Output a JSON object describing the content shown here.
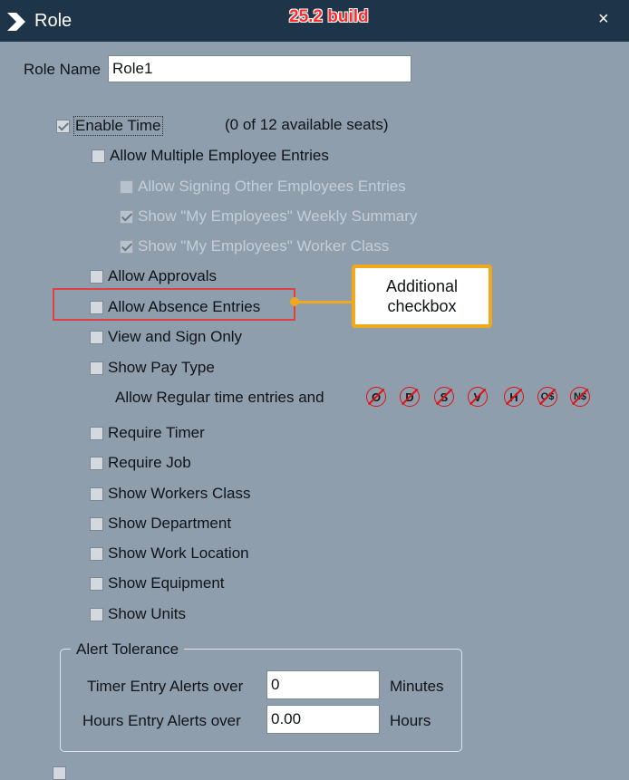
{
  "window": {
    "title": "Role",
    "build": "25.2 build",
    "close": "×"
  },
  "role_name": {
    "label": "Role Name",
    "value": "Role1"
  },
  "enable_time": {
    "label": "Enable Time",
    "checked": true,
    "seats": "(0 of 12 available seats)"
  },
  "options": [
    {
      "label": "Allow Multiple Employee Entries",
      "checked": false,
      "disabled": false
    },
    {
      "label": "Allow Signing Other Employees Entries",
      "checked": false,
      "disabled": true
    },
    {
      "label": "Show \"My Employees\" Weekly Summary",
      "checked": true,
      "disabled": true
    },
    {
      "label": "Show \"My Employees\" Worker Class",
      "checked": true,
      "disabled": true
    },
    {
      "label": "Allow Approvals",
      "checked": false,
      "disabled": false
    },
    {
      "label": "Allow Absence Entries",
      "checked": false,
      "disabled": false
    },
    {
      "label": "View and Sign Only",
      "checked": false,
      "disabled": false
    },
    {
      "label": "Show Pay Type",
      "checked": false,
      "disabled": false
    },
    {
      "label": "Require Timer",
      "checked": false,
      "disabled": false
    },
    {
      "label": "Require Job",
      "checked": false,
      "disabled": false
    },
    {
      "label": "Show Workers Class",
      "checked": false,
      "disabled": false
    },
    {
      "label": "Show Department",
      "checked": false,
      "disabled": false
    },
    {
      "label": "Show Work Location",
      "checked": false,
      "disabled": false
    },
    {
      "label": "Show Equipment",
      "checked": false,
      "disabled": false
    },
    {
      "label": "Show Units",
      "checked": false,
      "disabled": false
    }
  ],
  "pay_type": {
    "label": "Allow Regular time entries and",
    "icons": [
      "O",
      "D",
      "S",
      "V",
      "H",
      "O$",
      "N$"
    ]
  },
  "callout": {
    "line1": "Additional",
    "line2": "checkbox"
  },
  "alert_tolerance": {
    "legend": "Alert Tolerance",
    "timer": {
      "label": "Timer Entry Alerts over",
      "value": "0",
      "unit": "Minutes"
    },
    "hours": {
      "label": "Hours Entry Alerts over",
      "value": "0.00",
      "unit": "Hours"
    }
  },
  "colors": {
    "background": "#8e9ead",
    "titlebar": "#1e3448",
    "highlight": "#e04040",
    "callout_border": "#f0a81c",
    "build_label": "#ff2a2a"
  }
}
